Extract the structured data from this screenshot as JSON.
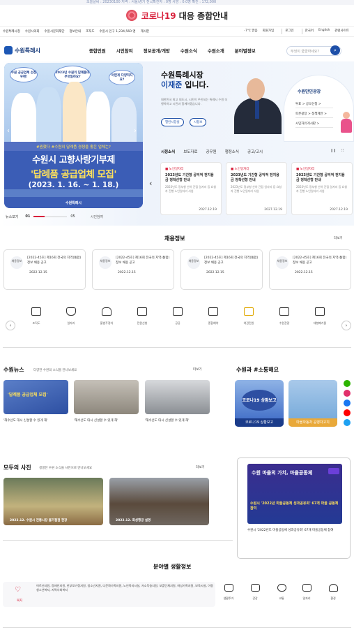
{
  "ticker": "오늘날씨 : 20230100   지역 : 서울/경기   전국확진자 : 0명   사망 : 0.0명   확진 : 172,000",
  "covid": {
    "title_red": "코로나19",
    "title_rest": " 대응 종합안내"
  },
  "util": {
    "links": [
      "수원특례시청",
      "수원시의회",
      "수원시문화재단",
      "정보안내",
      "조직도"
    ],
    "stat": "수원시 인구 1,234,560 명",
    "stat2": "계시판",
    "weather": "-7℃ 맑음",
    "right_links": [
      "회원가입",
      "로그인",
      "한국어",
      "English"
    ],
    "lang": "관련사이트"
  },
  "gnb": {
    "logo": "수원특례시",
    "menu": [
      "종합민원",
      "시민참여",
      "정보공개/개방",
      "수원소식",
      "수원소개",
      "분야별정보"
    ],
    "search_placeholder": "무엇이 궁금하세요?"
  },
  "banner": {
    "bubbles": [
      "수원 공공업체 선정 우편!",
      "2023년 수원의 답례품이 무엇일까요?",
      "어떤게 다양하지요?"
    ],
    "tag": "#찜했다 #수원의 답례품 경쟁을 좋은 업체는?",
    "line1": "수원시 고향사랑기부제",
    "line2": "'답례품 공급업체 모집'",
    "line3": "(2023. 1. 16. ~ 1. 18.)",
    "footer": "수원특례시",
    "nav_label": "뉴스보기",
    "nav_current": "01",
    "nav_total": "05",
    "nav_extra": "시민참여"
  },
  "mayor": {
    "title1": "수원특례시장",
    "name": "이재준",
    "title2": " 입니다.",
    "desc": "대한민국 최고 대도시, 시민이 주인되는 특례시 수원 더 행복하고 시민과 함께하겠습니다.",
    "btn1": "열린시장실",
    "btn2": "시정보"
  },
  "plaza": {
    "title": "수원만민광장",
    "items": [
      "투표 > 공모신청 >",
      "토론광장 > 정책제안 >",
      "시민자유게시판 >"
    ]
  },
  "news_tabs": [
    "시정소식",
    "보도자료",
    "공무원",
    "행정소식",
    "공고/고시"
  ],
  "news_cards": [
    {
      "tag": "■ 노인일자리",
      "title": "2023년도 기간형 공익적 전지용금 정착선형 안내",
      "desc": "2023년도 정부형 산하 간접 일자리 등 요청자 진행 노인일자리 사업",
      "date": "2027.12.19"
    },
    {
      "tag": "■ 노인일자리",
      "title": "2023년도 기간형 공익적 전지용금 정착선형 안내",
      "desc": "2023년도 정부형 산하 간접 일자리 등 요청자 진행 노인일자리 사업",
      "date": "2027.12.19"
    },
    {
      "tag": "■ 노인일자리",
      "title": "2023년도 기간형 공익적 전지용금 정착선형 안내",
      "desc": "2023년도 정부형 산하 간접 일자리 등 요청자 진행 노인일자리 사업",
      "date": "2027.12.19"
    }
  ],
  "jobs": {
    "title": "채용정보",
    "more": "더보기",
    "items": [
      {
        "badge": "채용정보",
        "title": "[2022-45호] 제16회 전국의 지역(통합)정보 채용 공고",
        "date": "2022.12.15"
      },
      {
        "badge": "채용정보",
        "title": "[2022-45호] 제16회 전국의 지역(통합)정보 채용 공고",
        "date": "2022.12.15"
      },
      {
        "badge": "채용정보",
        "title": "[2022-45호] 제16회 전국의 지역(통합)정보 채용 공고",
        "date": "2022.12.15"
      },
      {
        "badge": "채용정보",
        "title": "[2022-45호] 제16회 전국의 지역(통합)정보 채용 공고",
        "date": "2022.12.15"
      }
    ]
  },
  "quick": [
    "조직도",
    "일자리",
    "불법주정차",
    "민원신청",
    "공공",
    "종합예약",
    "여권민원",
    "수원관광",
    "대형폐기물"
  ],
  "suwon_news": {
    "title": "수원뉴스",
    "sub": "다양한 수원의 소식을 만나보세요",
    "more": "더보기",
    "items": [
      "'해수선도 대시 신설할 수 있게 해'",
      "'해수선도 대시 신설할 수 있게 해'",
      "'해수선도 대시 신설할 수 있게 해'"
    ]
  },
  "sotong": {
    "title": "수원과 #소통해요",
    "card1": "코로나19 상황보고",
    "card2": "마을자동차 공영차고지"
  },
  "photos": {
    "title": "모두의 사진",
    "sub": "생생한 수원 소식을 사진으로 만나보세요",
    "more": "더보기",
    "items": [
      "2022.12. 수원시 전통시장 물가점검 현장",
      "2022.12. 화성행궁 설경"
    ]
  },
  "video": {
    "caption": "수원 마을의 가치, 마을공동체",
    "banner": "수원시 '2022년 마을공동체 성과공유회' 67개 마을 공동체 참여",
    "desc": "수원시 '2022년도 마을공동체 성과공유회' 67개 마을공동체 참여"
  },
  "life": {
    "title": "분야별 생활정보",
    "main_label": "복지",
    "text": "어르신지원, 장애인지원, 한부모가정지원, 청소년지원, 다문화가족지원, 노인복지시설, 저소득층지원, 보훈단체지원, 여성가족지원, 보육시설, 아동청소년복지, 지역사회복지",
    "items": [
      "생활주거",
      "건강",
      "교통",
      "일자리",
      "환경"
    ]
  },
  "colors": {
    "brand": "#1d4fa8",
    "accent": "#d8203b"
  }
}
